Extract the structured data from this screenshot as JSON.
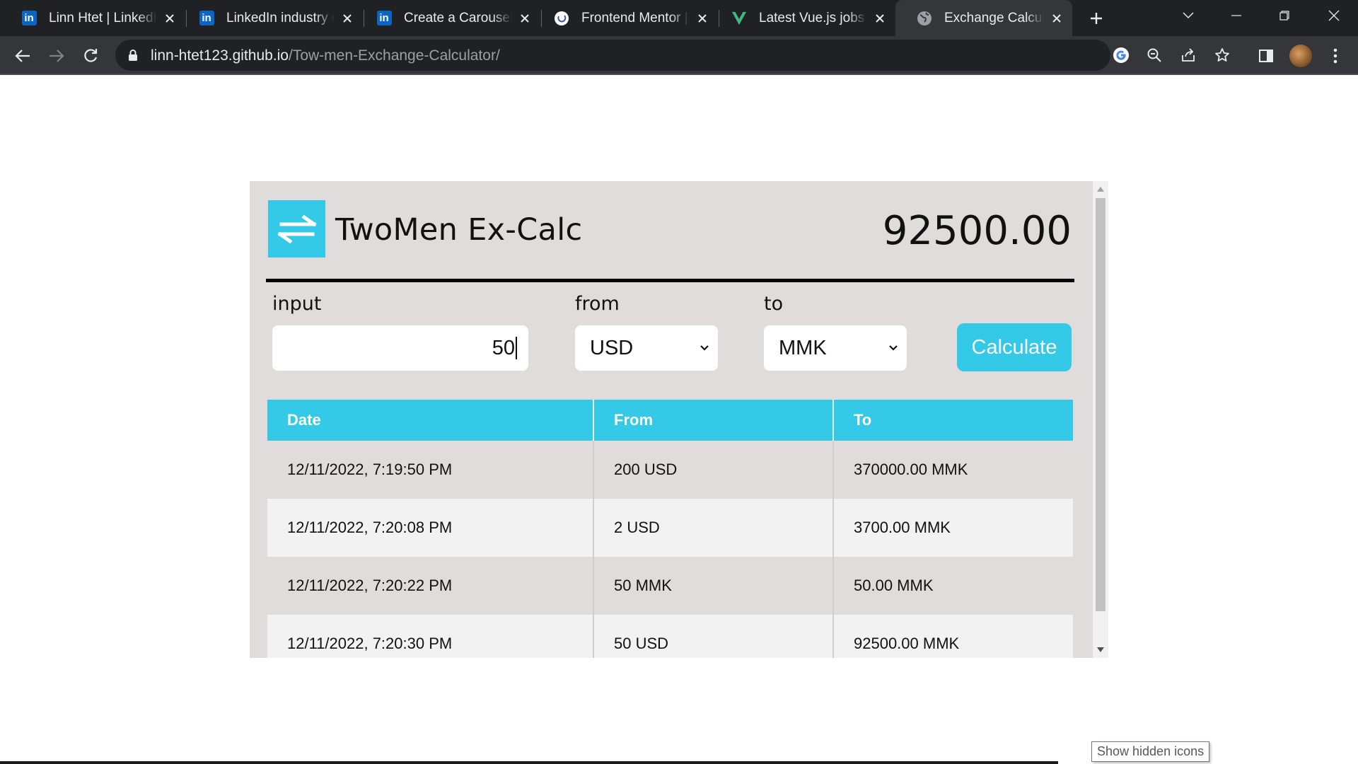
{
  "browser": {
    "tabs": [
      {
        "title": "Linn Htet | LinkedIn",
        "icon": "linkedin-icon"
      },
      {
        "title": "LinkedIn industry options",
        "icon": "linkedin-icon"
      },
      {
        "title": "Create a Carousel | Sentry",
        "icon": "linkedin-icon"
      },
      {
        "title": "Frontend Mentor | Solutions",
        "icon": "frontend-mentor-icon"
      },
      {
        "title": "Latest Vue.js jobs in",
        "icon": "vuejobs-icon"
      },
      {
        "title": "Exchange Calculator",
        "icon": "globe-icon",
        "active": true
      }
    ],
    "address": {
      "host": "linn-htet123.github.io",
      "path": "/Tow-men-Exchange-Calculator/"
    }
  },
  "app": {
    "brand": "TwoMen Ex-Calc",
    "result": "92500.00",
    "labels": {
      "input": "input",
      "from": "from",
      "to": "to"
    },
    "amount_value": "50",
    "from_currency": "USD",
    "to_currency": "MMK",
    "calculate_label": "Calculate",
    "history": {
      "headers": [
        "Date",
        "From",
        "To"
      ],
      "rows": [
        [
          "12/11/2022, 7:19:50 PM",
          "200 USD",
          "370000.00 MMK"
        ],
        [
          "12/11/2022, 7:20:08 PM",
          "2 USD",
          "3700.00 MMK"
        ],
        [
          "12/11/2022, 7:20:22 PM",
          "50 MMK",
          "50.00 MMK"
        ],
        [
          "12/11/2022, 7:20:30 PM",
          "50 USD",
          "92500.00 MMK"
        ]
      ]
    },
    "colors": {
      "accent": "#33c9e7",
      "panel": "#e1dcdc",
      "row_alt": "#f2f2f2"
    }
  },
  "taskbar": {
    "tooltip": "Show hidden icons"
  }
}
